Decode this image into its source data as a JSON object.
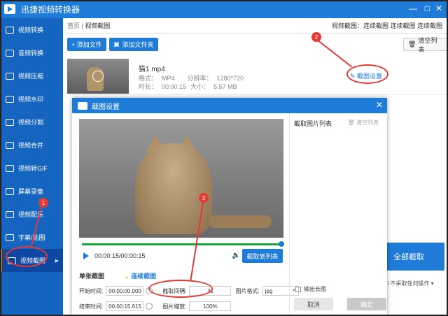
{
  "app": {
    "title": "迅捷视频转换器",
    "minimize": "—",
    "maximize": "□",
    "close": "✕"
  },
  "sidebar": {
    "items": [
      {
        "label": "视频转换",
        "icon": "video-convert-icon"
      },
      {
        "label": "音频转换",
        "icon": "audio-convert-icon"
      },
      {
        "label": "视频压缩",
        "icon": "compress-icon"
      },
      {
        "label": "视频水印",
        "icon": "watermark-icon"
      },
      {
        "label": "视频分割",
        "icon": "split-icon"
      },
      {
        "label": "视频合并",
        "icon": "merge-icon"
      },
      {
        "label": "视频转GIF",
        "icon": "gif-icon"
      },
      {
        "label": "屏幕录像",
        "icon": "record-icon"
      },
      {
        "label": "视频配乐",
        "icon": "music-icon"
      },
      {
        "label": "字幕/贴图",
        "icon": "subtitle-icon"
      },
      {
        "label": "视频截图",
        "icon": "screenshot-icon",
        "active": true
      }
    ]
  },
  "topbar": {
    "breadcrumb_home": "首页",
    "breadcrumb_sep": " ",
    "breadcrumb_current": "视频截图",
    "actions": "视频截图：连续截图 连续截图 连续截图"
  },
  "toolbar": {
    "add_file": "+ 添加文件",
    "add_folder": "添加文件夹",
    "clear_list": "清空列表"
  },
  "file": {
    "name": "猫1.mp4",
    "format_label": "格式：",
    "format": "MP4",
    "res_label": "分辨率：",
    "resolution": "1280*720",
    "duration_label": "时长：",
    "duration": "00:00:15",
    "size_label": "大小：",
    "size": "5.57 MB",
    "capture_settings": "截图设置"
  },
  "main": {
    "capture_all": "全部截取",
    "after_action": "不采取任何操作"
  },
  "annotations": {
    "badge1": "1",
    "badge2": "2",
    "badge3": "3"
  },
  "dialog": {
    "title": "截图设置",
    "close": "✕",
    "time_display": "00:00:15/00:00:15",
    "capture_to_list": "截取到列表",
    "tab_single": "单张截图",
    "tab_continuous": "连续截图",
    "start_label": "开始时间:",
    "start_value": "00:00:00.000",
    "end_label": "结束时间:",
    "end_value": "00:00:15.615",
    "interval_label": "截取间隔:",
    "interval_value": "3s",
    "format_label": "图片格式:",
    "format_value": "jpg",
    "scale_label": "图片缩放:",
    "scale_value": "100%",
    "list_title": "截取图片列表",
    "list_clear": "清空列表",
    "output_long": "输出长图",
    "cancel": "取消",
    "ok": "确定"
  }
}
